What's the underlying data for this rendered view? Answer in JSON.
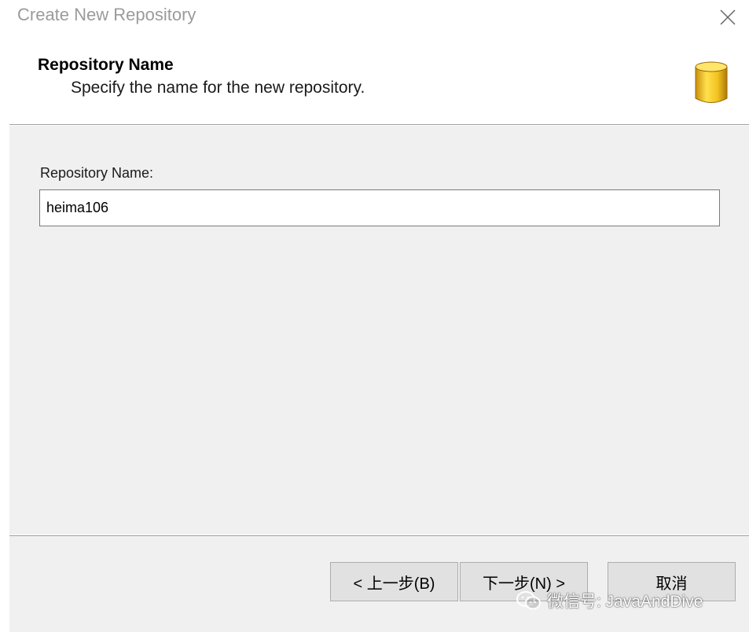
{
  "window": {
    "title": "Create New Repository",
    "close_icon": "close-icon"
  },
  "header": {
    "title": "Repository Name",
    "subtitle": "Specify the name for the new repository.",
    "icon": "database-icon",
    "icon_color": "#f2c220"
  },
  "form": {
    "label": "Repository Name:",
    "value": "heima106"
  },
  "buttons": {
    "back": "< 上一步(B)",
    "next": "下一步(N) >",
    "cancel": "取消"
  },
  "watermark": {
    "icon": "wechat-icon",
    "text": "微信号: JavaAndDive"
  },
  "colors": {
    "panel_background": "#f0f0f0",
    "button_background": "#e1e1e1",
    "title_text": "#9b9b9b"
  }
}
